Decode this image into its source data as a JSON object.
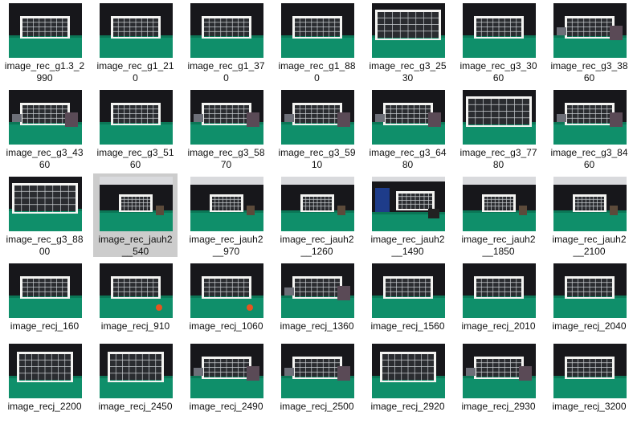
{
  "window": {
    "view": "large-icons",
    "selected_index": 15
  },
  "items": [
    {
      "line1": "image_rec_g1.3_2",
      "line2": "990",
      "scene": "dark"
    },
    {
      "line1": "image_rec_g1_21",
      "line2": "0",
      "scene": "dark"
    },
    {
      "line1": "image_rec_g1_37",
      "line2": "0",
      "scene": "dark"
    },
    {
      "line1": "image_rec_g1_88",
      "line2": "0",
      "scene": "dark"
    },
    {
      "line1": "image_rec_g3_25",
      "line2": "30",
      "scene": "close"
    },
    {
      "line1": "image_rec_g3_30",
      "line2": "60",
      "scene": "dark"
    },
    {
      "line1": "image_rec_g3_38",
      "line2": "60",
      "scene": "clutter"
    },
    {
      "line1": "image_rec_g3_43",
      "line2": "60",
      "scene": "clutter"
    },
    {
      "line1": "image_rec_g3_51",
      "line2": "60",
      "scene": "dark"
    },
    {
      "line1": "image_rec_g3_58",
      "line2": "70",
      "scene": "clutter"
    },
    {
      "line1": "image_rec_g3_59",
      "line2": "10",
      "scene": "clutter"
    },
    {
      "line1": "image_rec_g3_64",
      "line2": "80",
      "scene": "clutter"
    },
    {
      "line1": "image_rec_g3_77",
      "line2": "80",
      "scene": "close"
    },
    {
      "line1": "image_rec_g3_84",
      "line2": "60",
      "scene": "clutter"
    },
    {
      "line1": "image_rec_g3_88",
      "line2": "00",
      "scene": "close"
    },
    {
      "line1": "image_rec_jauh2",
      "line2": "__540",
      "scene": "far"
    },
    {
      "line1": "image_rec_jauh2",
      "line2": "__970",
      "scene": "far"
    },
    {
      "line1": "image_rec_jauh2",
      "line2": "__1260",
      "scene": "far"
    },
    {
      "line1": "image_rec_jauh2",
      "line2": "__1490",
      "scene": "banner"
    },
    {
      "line1": "image_rec_jauh2",
      "line2": "__1850",
      "scene": "far"
    },
    {
      "line1": "image_rec_jauh2",
      "line2": "__2100",
      "scene": "far"
    },
    {
      "line1": "image_recj_160",
      "line2": "",
      "scene": "dark"
    },
    {
      "line1": "image_recj_910",
      "line2": "",
      "scene": "ball"
    },
    {
      "line1": "image_recj_1060",
      "line2": "",
      "scene": "ball"
    },
    {
      "line1": "image_recj_1360",
      "line2": "",
      "scene": "clutter"
    },
    {
      "line1": "image_recj_1560",
      "line2": "",
      "scene": "dark"
    },
    {
      "line1": "image_recj_2010",
      "line2": "",
      "scene": "dark"
    },
    {
      "line1": "image_recj_2040",
      "line2": "",
      "scene": "dark"
    },
    {
      "line1": "image_recj_2200",
      "line2": "",
      "scene": "side"
    },
    {
      "line1": "image_recj_2450",
      "line2": "",
      "scene": "side"
    },
    {
      "line1": "image_recj_2490",
      "line2": "",
      "scene": "clutter"
    },
    {
      "line1": "image_recj_2500",
      "line2": "",
      "scene": "clutter"
    },
    {
      "line1": "image_recj_2920",
      "line2": "",
      "scene": "side"
    },
    {
      "line1": "image_recj_2930",
      "line2": "",
      "scene": "clutter"
    },
    {
      "line1": "image_recj_3200",
      "line2": "",
      "scene": "dark"
    }
  ],
  "colors": {
    "turf": "#0f8f6a",
    "turf_dark": "#0b7656",
    "curtain": "#17171b",
    "wall": "#d9dadd",
    "goal": "#f4f4f2",
    "net": "#c9cdd0",
    "selected_bg": "#cccccc"
  }
}
